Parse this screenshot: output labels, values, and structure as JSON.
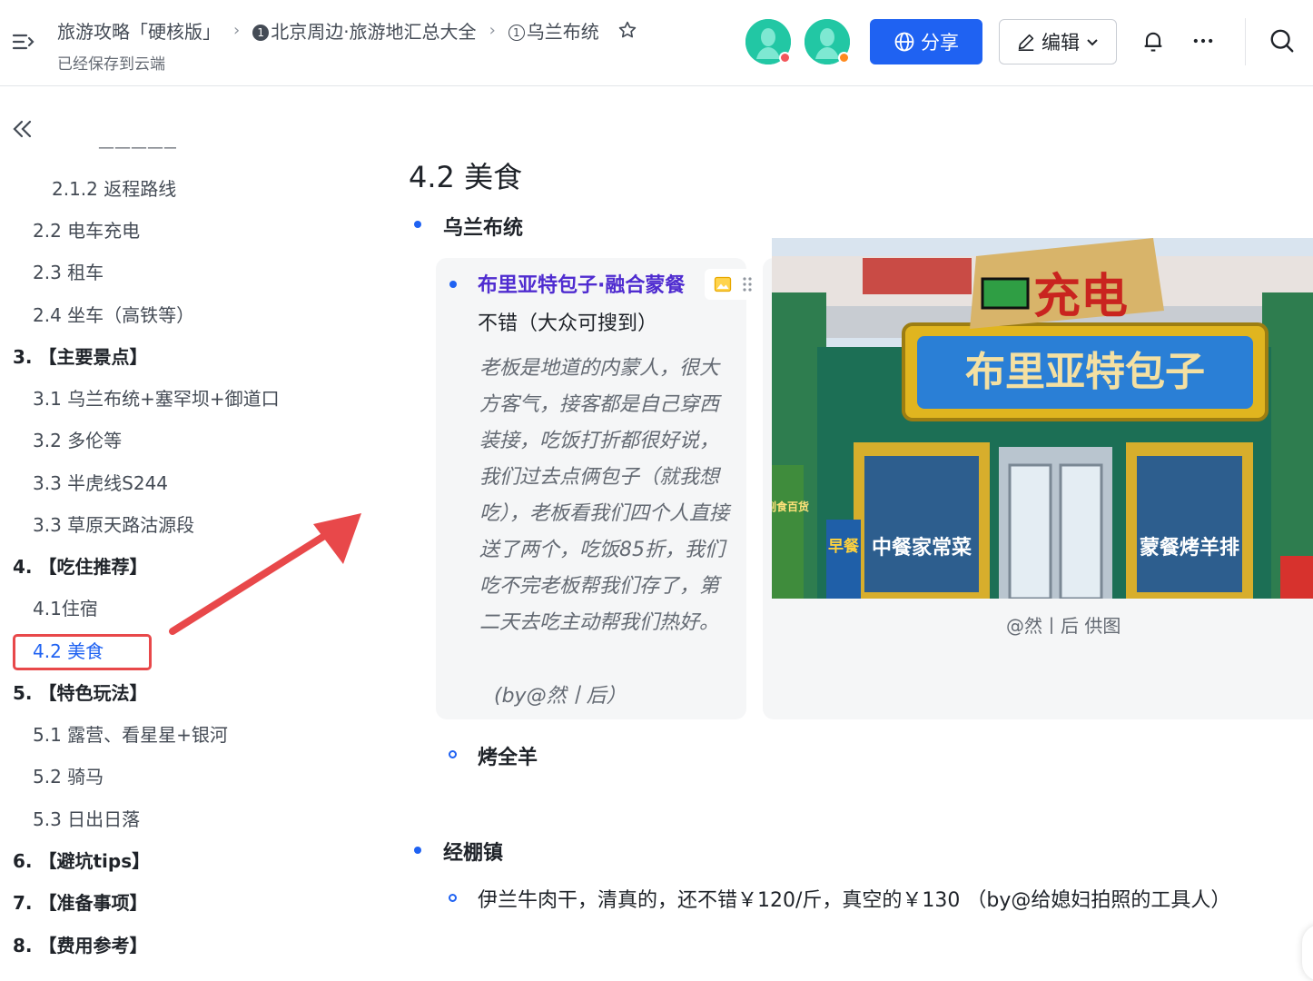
{
  "header": {
    "breadcrumbs": [
      {
        "label": "旅游攻略「硬核版」"
      },
      {
        "marker": "❶",
        "label": "北京周边·旅游地汇总大全"
      },
      {
        "marker": "①",
        "label": "乌兰布统"
      }
    ],
    "save_status": "已经保存到云端",
    "share_label": "分享",
    "edit_label": "编辑",
    "avatars": [
      {
        "name": "avatar-1",
        "bg": "#21c3a0",
        "dot_color": "#f2565a"
      },
      {
        "name": "avatar-2",
        "bg": "#21c3a0",
        "dot_color": "#ff8a1f"
      }
    ],
    "colors": {
      "primary": "#1f62f2",
      "border": "#e3e5e8"
    }
  },
  "toc": {
    "items": [
      {
        "label": "2.1.2 返程路线",
        "level": 2
      },
      {
        "label": "2.2 电车充电",
        "level": 1
      },
      {
        "label": "2.3 租车",
        "level": 1
      },
      {
        "label": "2.4 坐车（高铁等）",
        "level": 1
      },
      {
        "label": "3. 【主要景点】",
        "level": 0
      },
      {
        "label": "3.1 乌兰布统+塞罕坝+御道口",
        "level": 1
      },
      {
        "label": "3.2 多伦等",
        "level": 1
      },
      {
        "label": "3.3 半虎线S244",
        "level": 1
      },
      {
        "label": "3.3 草原天路沽源段",
        "level": 1
      },
      {
        "label": "4. 【吃住推荐】",
        "level": 0
      },
      {
        "label": "4.1住宿",
        "level": 1
      },
      {
        "label": "4.2 美食",
        "level": 1,
        "active": true
      },
      {
        "label": "5. 【特色玩法】",
        "level": 0
      },
      {
        "label": "5.1 露营、看星星+银河",
        "level": 1
      },
      {
        "label": "5.2 骑马",
        "level": 1
      },
      {
        "label": "5.3 日出日落",
        "level": 1
      },
      {
        "label": "6. 【避坑tips】",
        "level": 0
      },
      {
        "label": "7. 【准备事项】",
        "level": 0
      },
      {
        "label": "8. 【费用参考】",
        "level": 0
      }
    ],
    "highlight_color": "#e8484a"
  },
  "doc": {
    "heading": "4.2 美食",
    "section1": {
      "title": "乌兰布统",
      "restaurant_name": "布里亚特包子·融合蒙餐",
      "restaurant_note": "不错（大众可搜到）",
      "quote": "老板是地道的内蒙人，很大方客气，接客都是自己穿西装接，吃饭打折都很好说，我们过去点俩包子（就我想吃），老板看我们四个人直接送了两个，吃饭85折，我们吃不完老板帮我们存了，第二天去吃主动帮我们热好。",
      "quote_by": "(by@然丨后）",
      "photo": {
        "sign_main": "布里亚特包子",
        "sign_top": "充电",
        "sign_left_bottom": "中餐家常菜",
        "sign_right_bottom": "蒙餐烤羊排",
        "sign_side": "早餐",
        "sign_side2": "副食百货"
      },
      "photo_caption": "@然丨后 供图",
      "sub_item": "烤全羊"
    },
    "section2": {
      "title": "经棚镇",
      "item": "伊兰牛肉干，清真的，还不错￥120/斤，真空的￥130 （by@给媳妇拍照的工具人）"
    }
  }
}
